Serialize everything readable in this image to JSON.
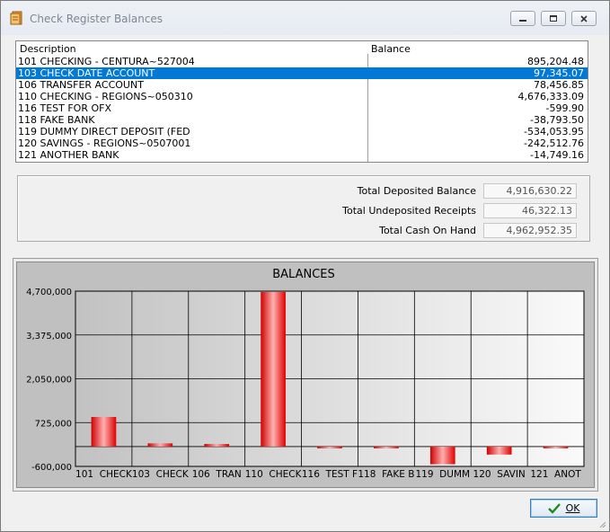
{
  "window": {
    "title": "Check Register Balances"
  },
  "list": {
    "headers": {
      "description": "Description",
      "balance": "Balance"
    },
    "rows": [
      {
        "description": "101  CHECKING - CENTURA~527004",
        "balance": "895,204.48"
      },
      {
        "description": "103  CHECK DATE ACCOUNT",
        "balance": "97,345.07",
        "selected": true
      },
      {
        "description": "106  TRANSFER ACCOUNT",
        "balance": "78,456.85"
      },
      {
        "description": "110  CHECKING - REGIONS~050310",
        "balance": "4,676,333.09"
      },
      {
        "description": "116  TEST FOR OFX",
        "balance": "-599.90"
      },
      {
        "description": "118  FAKE BANK",
        "balance": "-38,793.50"
      },
      {
        "description": "119  DUMMY DIRECT DEPOSIT (FED",
        "balance": "-534,053.95"
      },
      {
        "description": "120  SAVINGS - REGIONS~0507001",
        "balance": "-242,512.76"
      },
      {
        "description": "121  ANOTHER BANK",
        "balance": "-14,749.16"
      }
    ]
  },
  "totals": {
    "deposited_label": "Total Deposited Balance",
    "deposited_value": "4,916,630.22",
    "undeposited_label": "Total Undeposited Receipts",
    "undeposited_value": "46,322.13",
    "cash_label": "Total Cash On Hand",
    "cash_value": "4,962,952.35"
  },
  "chart_data": {
    "type": "bar",
    "title": "BALANCES",
    "categories": [
      "101  CHECK",
      "103  CHECK",
      "106  TRAN",
      "110  CHECK",
      "116  TEST F",
      "118  FAKE B",
      "119  DUMM",
      "120  SAVIN",
      "121  ANOT"
    ],
    "values": [
      895204.48,
      97345.07,
      78456.85,
      4676333.09,
      -599.9,
      -38793.5,
      -534053.95,
      -242512.76,
      -14749.16
    ],
    "y_ticks": [
      "4,700,000",
      "3,375,000",
      "2,050,000",
      "725,000",
      "-600,000"
    ],
    "ylim": [
      -600000,
      4700000
    ],
    "grid": true,
    "bar_color": "#ff0000"
  },
  "buttons": {
    "ok_label": "OK"
  }
}
